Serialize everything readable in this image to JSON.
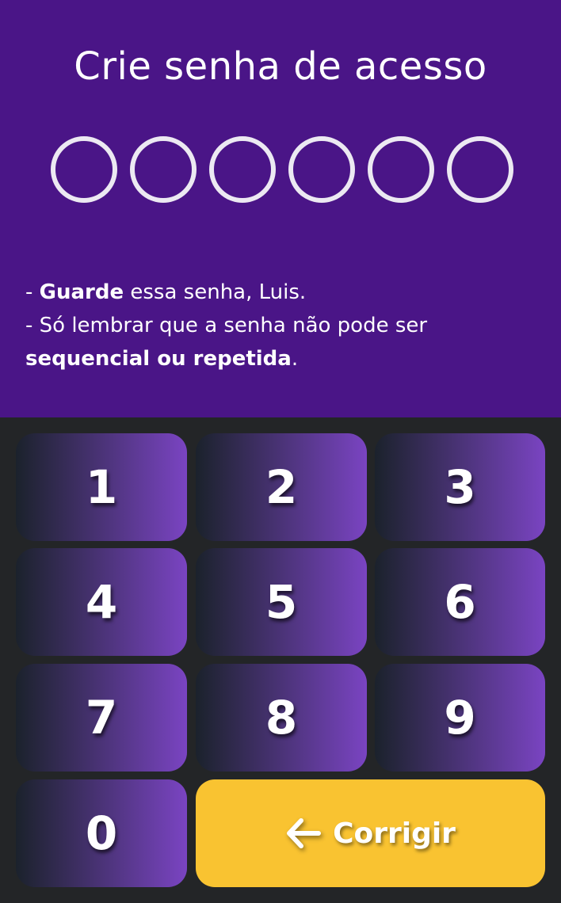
{
  "header": {
    "title": "Crie senha de acesso",
    "pin_slots": 6,
    "info_line1_bold": "Guarde",
    "info_line1_rest": " essa senha, Luis.",
    "info_line2": "- Só lembrar que a senha não pode ser",
    "info_line3_bold": "sequencial ou repetida",
    "info_line3_rest": "."
  },
  "keypad": {
    "keys": [
      "1",
      "2",
      "3",
      "4",
      "5",
      "6",
      "7",
      "8",
      "9",
      "0"
    ],
    "correct_label": "Corrigir",
    "correct_icon": "arrow-left-icon"
  },
  "colors": {
    "header_bg": "#4a1587",
    "pad_bg": "#232527",
    "key_gradient_start": "#1b222c",
    "key_gradient_end": "#7a44c2",
    "correct_bg": "#f9c331",
    "pin_ring": "#ece9f2"
  }
}
